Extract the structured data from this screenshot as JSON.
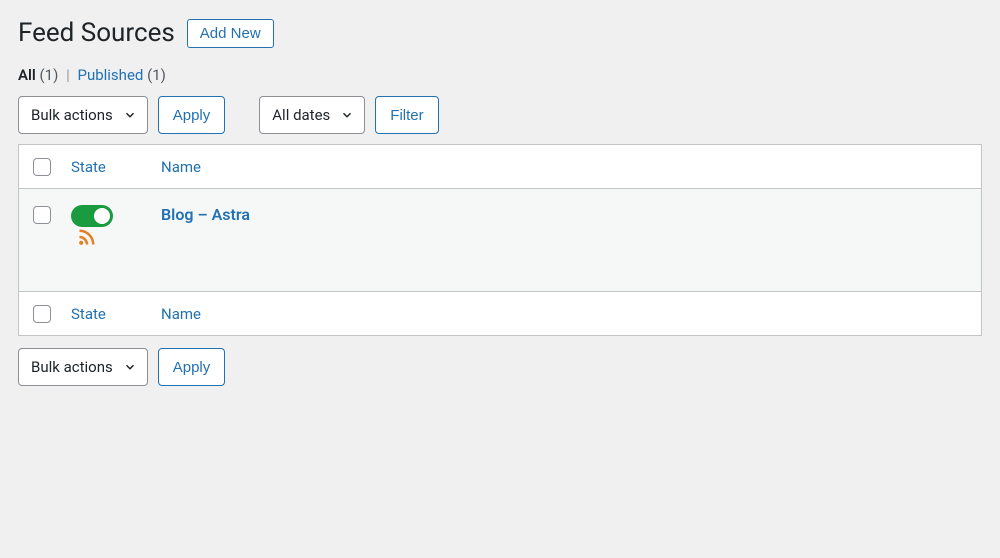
{
  "header": {
    "page_title": "Feed Sources",
    "add_new_label": "Add New"
  },
  "subsubsub": {
    "all_label": "All",
    "all_count": "(1)",
    "published_label": "Published",
    "published_count": "(1)",
    "separator": "|"
  },
  "tablenav_top": {
    "bulk_actions_label": "Bulk actions",
    "apply_label": "Apply",
    "all_dates_label": "All dates",
    "filter_label": "Filter"
  },
  "tablenav_bottom": {
    "bulk_actions_label": "Bulk actions",
    "apply_label": "Apply"
  },
  "table": {
    "columns": {
      "state": "State",
      "name": "Name"
    },
    "rows": [
      {
        "name": "Blog – Astra",
        "state_on": true
      }
    ]
  },
  "colors": {
    "link": "#2271b1",
    "toggle_on": "#1a9b3f",
    "rss": "#e67e22"
  }
}
